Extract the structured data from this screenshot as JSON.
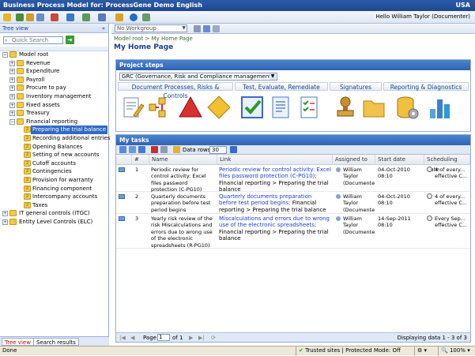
{
  "window": {
    "title": "Business Process Model for: ProcessGene Demo English",
    "locale": "USA",
    "greeting": "Hello William Taylor (Documenter)"
  },
  "tree_view": {
    "header": "Tree view",
    "collapse_symbol": "«",
    "search_placeholder": "Quick Search",
    "items": [
      {
        "label": "Model root",
        "pm": "−"
      },
      {
        "label": "Revenue",
        "pm": "+"
      },
      {
        "label": "Expenditure",
        "pm": "+"
      },
      {
        "label": "Payroll",
        "pm": "+"
      },
      {
        "label": "Procure to pay",
        "pm": "+"
      },
      {
        "label": "Inventory management",
        "pm": "+"
      },
      {
        "label": "Fixed assets",
        "pm": "+"
      },
      {
        "label": "Treasury",
        "pm": "+"
      },
      {
        "label": "Financial reporting",
        "pm": "−"
      },
      {
        "label": "Preparing the trial balance"
      },
      {
        "label": "Recording additional entries"
      },
      {
        "label": "Opening Balances"
      },
      {
        "label": "Setting of new accounts"
      },
      {
        "label": "Cutoff accounts"
      },
      {
        "label": "Contingencies"
      },
      {
        "label": "Provision for warranty"
      },
      {
        "label": "Financing component"
      },
      {
        "label": "Intercompany accounts"
      },
      {
        "label": "Taxes"
      },
      {
        "label": "IT general controls (ITGC)",
        "pm": "+"
      },
      {
        "label": "Entity Level Controls (ELC)",
        "pm": "+"
      }
    ],
    "tabs": [
      "Tree view",
      "Search results"
    ]
  },
  "workgroup": "No Workgroup",
  "breadcrumb": "Model root > My Home Page",
  "page_title": "My Home Page",
  "project_steps": {
    "header": "Project steps",
    "selector": "GRC (Governance, Risk and Compliance management)",
    "categories": [
      "Document Processes, Risks & Controls",
      "Test, Evaluate, Remediate",
      "Signatures",
      "Reporting & Diagnostics"
    ]
  },
  "my_tasks": {
    "header": "My tasks",
    "data_rows_label": "Data rows:",
    "data_rows_value": "30",
    "columns": [
      "#",
      "Name",
      "Link",
      "Assigned to",
      "Start date",
      "Scheduling date"
    ],
    "rows": [
      {
        "num": "1",
        "name": "Periodic review for control activity: Excel files password protection (C-PG10)",
        "link_blue": "Periodic review for control activity: Excel files password protection (C-PG10);",
        "link_rest": "Financial reporting > Preparing the trial balance",
        "assigned": "William Taylor (Documenter)",
        "start": "04-Oct-2010 08:10",
        "sched": "4 of every... effective C..."
      },
      {
        "num": "2",
        "name": "Quarterly documents preparation before test period begins",
        "link_blue": "Quarterly documents preparation before test period begins;",
        "link_rest": "Financial reporting > Preparing the trial balance",
        "assigned": "William Taylor (Documenter)",
        "start": "04-Oct-2010 08:10",
        "sched": "4 of every... effective C..."
      },
      {
        "num": "3",
        "name": "Yearly risk review of the risk Miscalculations and errors due to wrong use of the electronic spreadsheets (R-PG10)",
        "link_blue": "Miscalculations and errors due to wrong use of the electronic spreadsheets;",
        "link_rest": "Financial reporting > Preparing the trial balance",
        "assigned": "William Taylor (Documenter)",
        "start": "14-Sep-2011 08:10",
        "sched": "Every Sep... effective C..."
      }
    ],
    "page_label": "Page",
    "page_value": "1",
    "page_of": "of 1",
    "displaying": "Displaying data 1 - 3 of 3"
  },
  "statusbar": {
    "left": "Done",
    "zone": "Trusted sites | Protected Mode: Off",
    "zoom": "100%"
  }
}
